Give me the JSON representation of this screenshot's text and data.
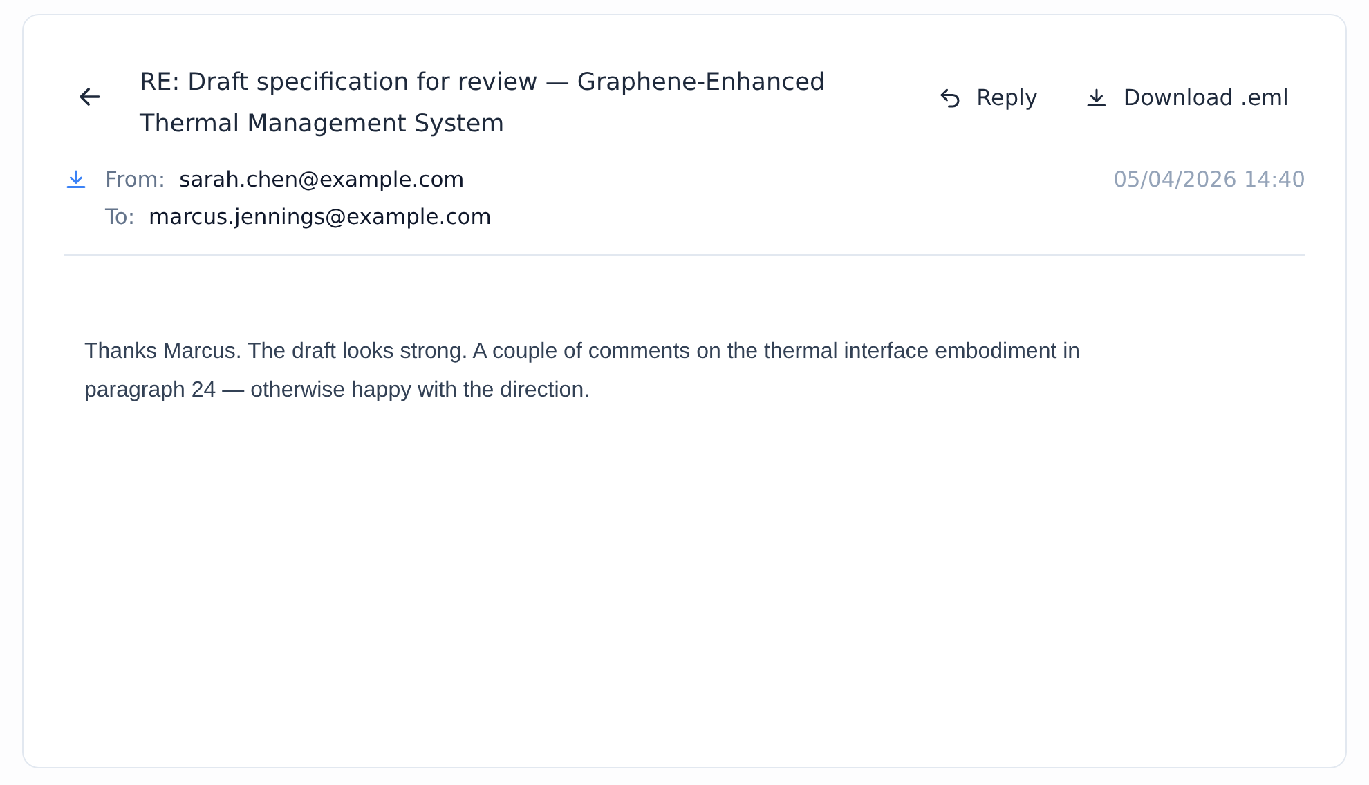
{
  "email": {
    "subject": "RE: Draft specification for review — Graphene-Enhanced Thermal Management System",
    "actions": [
      {
        "kind": "reply",
        "label": "Reply"
      },
      {
        "kind": "download",
        "label": "Download .eml"
      }
    ],
    "from_label": "From:",
    "from": "sarah.chen@example.com",
    "to_label": "To:",
    "to": "marcus.jennings@example.com",
    "date": "05/04/2026 14:40",
    "body": "Thanks Marcus. The draft looks strong. A couple of comments on the thermal interface embodiment in paragraph 24 — otherwise happy with the direction."
  }
}
